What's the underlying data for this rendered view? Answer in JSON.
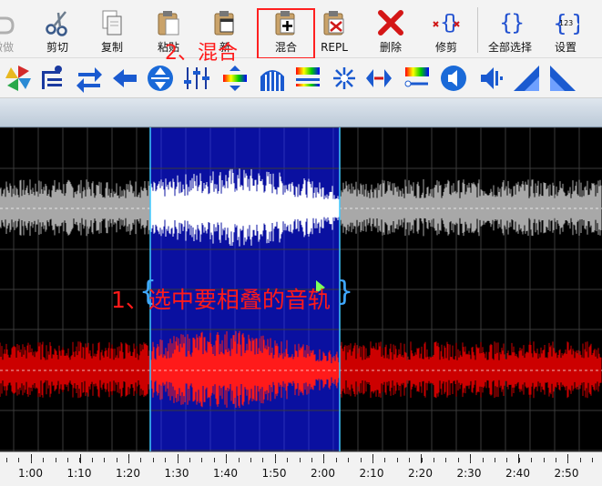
{
  "toolbar": {
    "undo_label": "撤做",
    "cut_label": "剪切",
    "copy_label": "复制",
    "paste_label": "粘贴",
    "new_label": "新",
    "mix_label": "混合",
    "repl_label": "REPL",
    "delete_label": "删除",
    "trim_label": "修剪",
    "select_all_label": "全部选择",
    "settings_label": "设置",
    "settings_icon_text": "123"
  },
  "annotations": {
    "step1": "1、选中要相叠的音轨",
    "step2": "2、混合"
  },
  "timeline": {
    "labels": [
      "1:00",
      "1:10",
      "1:20",
      "1:30",
      "1:40",
      "1:50",
      "2:00",
      "2:10",
      "2:20",
      "2:30",
      "2:40",
      "2:50"
    ]
  },
  "colors": {
    "selection": "#0a10a0",
    "selection_edge": "#3fc8ff",
    "top_wave": "#a8a8a8",
    "top_wave_selected": "#ffffff",
    "bottom_wave": "#cc0000",
    "bottom_wave_selected": "#ff1a1a",
    "annotation": "#ff1a1a"
  }
}
